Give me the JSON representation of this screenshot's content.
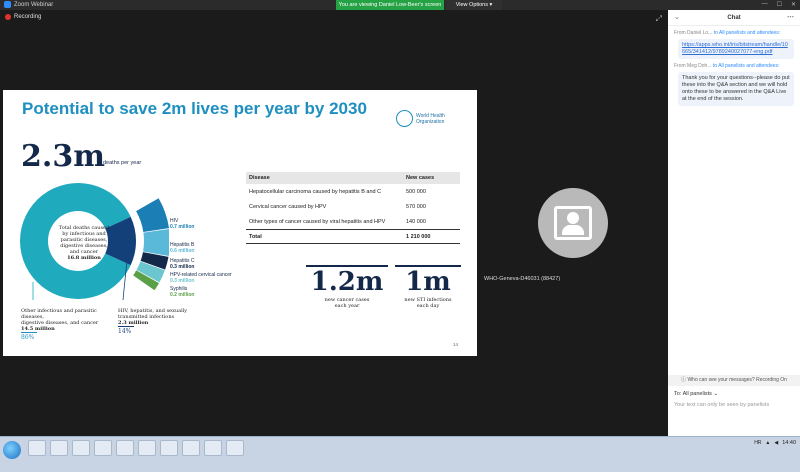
{
  "window": {
    "app_title": "Zoom Webinar",
    "banner": "You are viewing Daniel Low-Beer's screen",
    "view_options": "View Options"
  },
  "recording": "Recording",
  "slide": {
    "title": "Potential to save 2m lives per year by 2030",
    "who_line1": "World Health",
    "who_line2": "Organization",
    "big_stat": "2.3m",
    "big_stat_label": "deaths per year",
    "center_text": [
      "Total deaths caused",
      "by infectious and",
      "parasitic diseases,",
      "digestive diseases,",
      "and cancer"
    ],
    "center_value": "16.8 million",
    "legend": [
      {
        "name": "HIV",
        "value": "0.7 million",
        "color": "#1b7fb5"
      },
      {
        "name": "Hepatitis B",
        "value": "0.6 million",
        "color": "#5ab9d8"
      },
      {
        "name": "Hepatitis C",
        "value": "0.3 million",
        "color": "#14294a"
      },
      {
        "name": "HPV-related cervical cancer",
        "value": "0.3 million",
        "color": "#6cc6cf"
      },
      {
        "name": "Syphilis",
        "value": "0.2 million",
        "color": "#5aa046"
      }
    ],
    "left_caption": [
      "Other infectious and parasitic diseases,",
      "digestive diseases, and cancer"
    ],
    "left_value": "14.5 million",
    "left_pct": "86%",
    "right_caption": [
      "HIV, hepatitis, and sexually",
      "transmitted infections"
    ],
    "right_value": "2.3 million",
    "right_pct": "14%",
    "table": {
      "headers": [
        "Disease",
        "New cases"
      ],
      "rows": [
        [
          "Hepatocellular carcinoma caused by hepatitis B and C",
          "500 000"
        ],
        [
          "Cervical cancer caused by HPV",
          "570 000"
        ],
        [
          "Other types of cancer caused by viral hepatitis and HPV",
          "140 000"
        ]
      ],
      "total": [
        "Total",
        "1 210 000"
      ]
    },
    "stat1": {
      "value": "1.2m",
      "label1": "new cancer cases",
      "label2": "each year"
    },
    "stat2": {
      "value": "1m",
      "label1": "new STI infections",
      "label2": "each day"
    },
    "page": "14"
  },
  "participant_name": "WHO-Geneva-D46031 (88427)",
  "chat": {
    "title": "Chat",
    "messages": [
      {
        "from": "From Daniel Lo...",
        "to": "to All panelists and attendees:",
        "text": "https://apps.who.int/iris/bitstream/handle/10665/341412/9789240027077-eng.pdf",
        "is_link": true
      },
      {
        "from": "From Meg Doh...",
        "to": "to All panelists and attendees:",
        "text": "Thank you for your questions--please do put these into the Q&A section and we will hold onto these to be answered in the Q&A Live at the end of the session.",
        "is_link": false
      }
    ],
    "visibility": "Who can see your messages? Recording On",
    "to_label": "To:",
    "to_value": "All panelists",
    "hint": "Your text can only be seen by panelists"
  },
  "taskbar": {
    "lang": "HR",
    "time": "14:40"
  },
  "chart_data": {
    "type": "pie",
    "categories": [
      "Other infectious and parasitic diseases, digestive diseases, and cancer",
      "HIV, hepatitis, and sexually transmitted infections"
    ],
    "values": [
      14.5,
      2.3
    ],
    "breakdown": {
      "categories": [
        "HIV",
        "Hepatitis B",
        "Hepatitis C",
        "HPV-related cervical cancer",
        "Syphilis"
      ],
      "values": [
        0.7,
        0.6,
        0.3,
        0.3,
        0.2
      ]
    },
    "colors": [
      "#1faabe",
      "#14407a"
    ]
  }
}
